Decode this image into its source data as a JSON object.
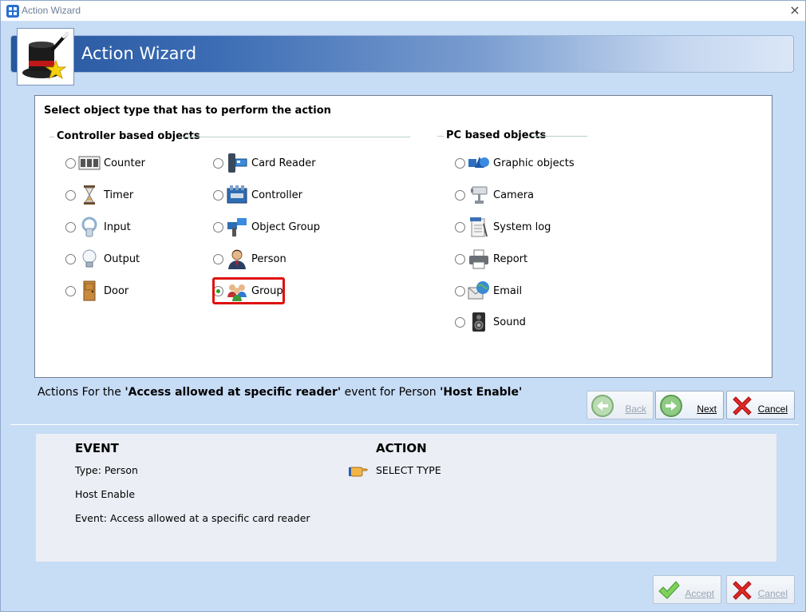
{
  "window": {
    "title": "Action Wizard",
    "close_glyph": "×"
  },
  "header": {
    "title": "Action Wizard",
    "icon": "magic-hat-icon"
  },
  "selector": {
    "heading": "Select object type that has to perform the action",
    "controller_group": {
      "title": "Controller based objects",
      "options": [
        {
          "label": "Counter",
          "icon": "counter-icon",
          "checked": false
        },
        {
          "label": "Timer",
          "icon": "hourglass-icon",
          "checked": false
        },
        {
          "label": "Input",
          "icon": "input-icon",
          "checked": false
        },
        {
          "label": "Output",
          "icon": "lightbulb-icon",
          "checked": false
        },
        {
          "label": "Door",
          "icon": "door-icon",
          "checked": false
        },
        {
          "label": "Card Reader",
          "icon": "card-reader-icon",
          "checked": false
        },
        {
          "label": "Controller",
          "icon": "controller-board-icon",
          "checked": false
        },
        {
          "label": "Object Group",
          "icon": "object-group-icon",
          "checked": false
        },
        {
          "label": "Person",
          "icon": "person-icon",
          "checked": false
        },
        {
          "label": "Group",
          "icon": "people-group-icon",
          "checked": true
        }
      ]
    },
    "pc_group": {
      "title": "PC based objects",
      "options": [
        {
          "label": "Graphic objects",
          "icon": "graphic-objects-icon",
          "checked": false
        },
        {
          "label": "Camera",
          "icon": "camera-icon",
          "checked": false
        },
        {
          "label": "System log",
          "icon": "system-log-icon",
          "checked": false
        },
        {
          "label": "Report",
          "icon": "printer-icon",
          "checked": false
        },
        {
          "label": "Email",
          "icon": "email-icon",
          "checked": false
        },
        {
          "label": "Sound",
          "icon": "speaker-icon",
          "checked": false
        }
      ]
    }
  },
  "actions_line": {
    "prefix": "Actions  For the ",
    "event": "'Access allowed at specific reader'",
    "middle": " event for Person ",
    "person": "'Host Enable'"
  },
  "nav_buttons": {
    "back": {
      "label": "Back",
      "enabled": false
    },
    "next": {
      "label": "Next",
      "enabled": true
    },
    "cancel": {
      "label": "Cancel",
      "enabled": true
    }
  },
  "summary": {
    "event_heading": "EVENT",
    "event_type": "Type: Person",
    "event_name": "Host  Enable",
    "event_desc": "Event: Access allowed at a specific card reader",
    "action_heading": "ACTION",
    "action_value": "SELECT TYPE"
  },
  "footer_buttons": {
    "accept": {
      "label": "Accept",
      "enabled": false
    },
    "cancel": {
      "label": "Cancel",
      "enabled": false
    }
  },
  "colors": {
    "window_bg": "#c7dcf5",
    "header_gradient_start": "#27579e",
    "selected_outline": "#e01010",
    "radio_checked": "#23a023"
  }
}
